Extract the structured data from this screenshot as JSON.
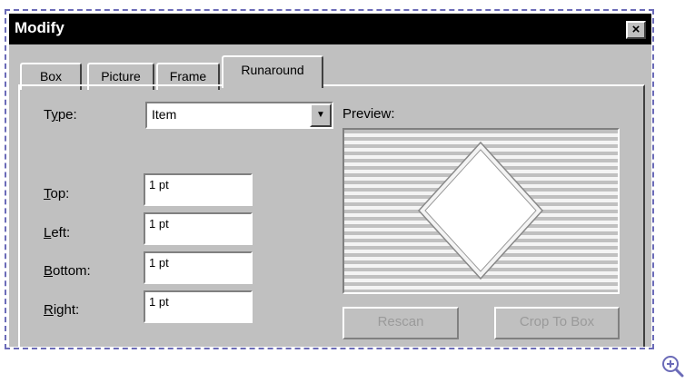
{
  "window": {
    "title": "Modify",
    "close_label": "×"
  },
  "tabs": [
    {
      "label": "Box"
    },
    {
      "label": "Picture"
    },
    {
      "label": "Frame"
    },
    {
      "label": "Runaround"
    }
  ],
  "active_tab": "Runaround",
  "type_field": {
    "label_prefix": "T",
    "label_accel": "y",
    "label_suffix": "pe:",
    "value": "Item"
  },
  "offsets": [
    {
      "accel": "T",
      "rest": "op:",
      "value": "1 pt"
    },
    {
      "accel": "L",
      "rest": "eft:",
      "value": "1 pt"
    },
    {
      "accel": "B",
      "rest": "ottom:",
      "value": "1 pt"
    },
    {
      "accel": "R",
      "rest": "ight:",
      "value": "1 pt"
    }
  ],
  "preview": {
    "label": "Preview:"
  },
  "buttons": {
    "rescan": "Rescan",
    "crop_to_box": "Crop To Box"
  },
  "colors": {
    "titlebar": "#000000",
    "dialog_bg": "#c0c0c0",
    "frame_dash": "#6b6bb8",
    "preview_stripe": "#c0c0c0"
  },
  "icons": {
    "close": "close-icon",
    "dropdown": "chevron-down-icon",
    "zoom": "zoom-in-icon"
  }
}
